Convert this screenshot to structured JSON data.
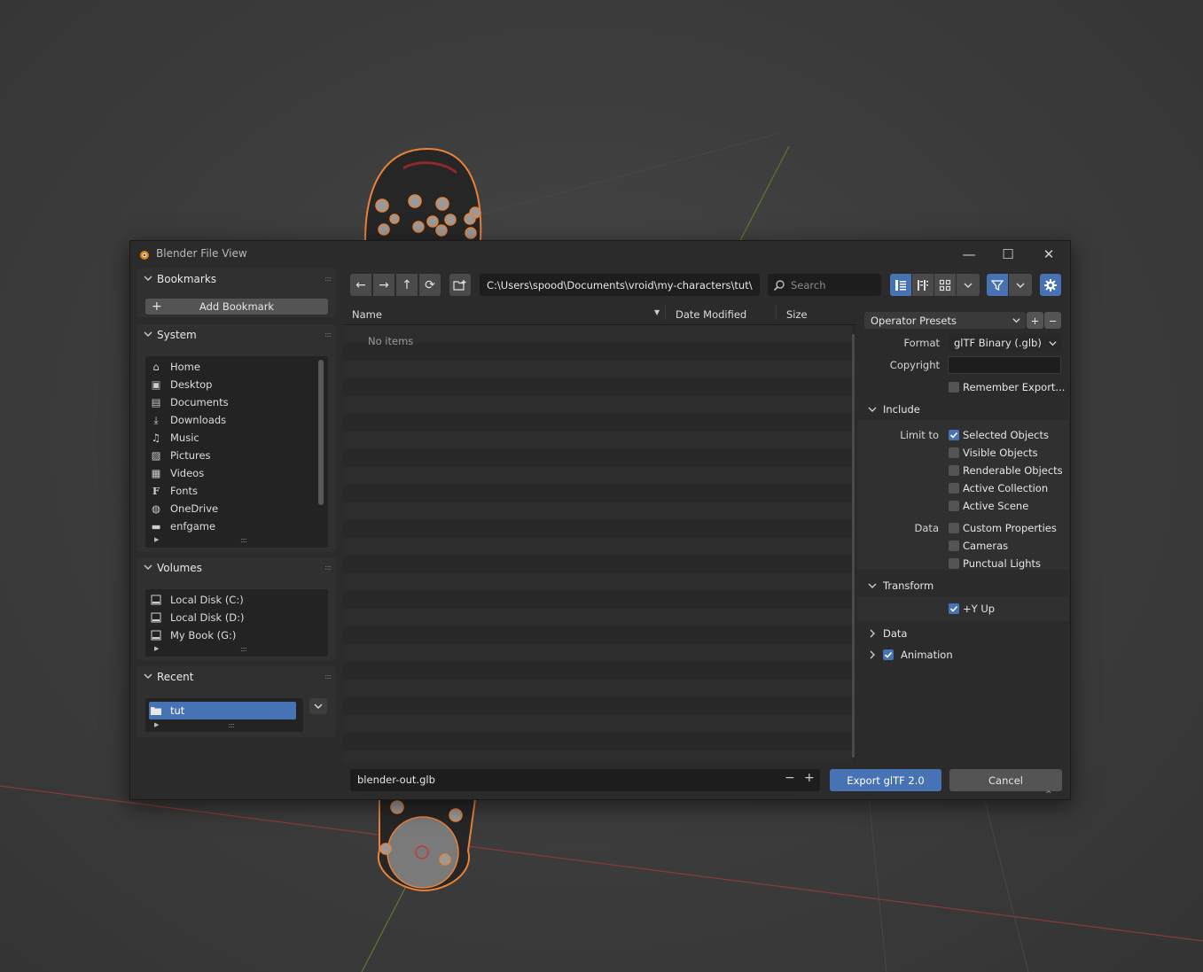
{
  "window": {
    "title": "Blender File View",
    "minimize_glyph": "—",
    "maximize_glyph": "☐",
    "close_glyph": "✕"
  },
  "sidebar": {
    "bookmarks": {
      "title": "Bookmarks",
      "add_label": "Add Bookmark",
      "add_icon": "+"
    },
    "system": {
      "title": "System",
      "items": [
        {
          "label": "Home",
          "icon": "home-icon",
          "glyph": "⌂"
        },
        {
          "label": "Desktop",
          "icon": "desktop-icon",
          "glyph": "▣"
        },
        {
          "label": "Documents",
          "icon": "documents-icon",
          "glyph": "▤"
        },
        {
          "label": "Downloads",
          "icon": "downloads-icon",
          "glyph": "⤓"
        },
        {
          "label": "Music",
          "icon": "music-icon",
          "glyph": "♫"
        },
        {
          "label": "Pictures",
          "icon": "pictures-icon",
          "glyph": "▨"
        },
        {
          "label": "Videos",
          "icon": "videos-icon",
          "glyph": "▦"
        },
        {
          "label": "Fonts",
          "icon": "fonts-icon",
          "glyph": "F"
        },
        {
          "label": "OneDrive",
          "icon": "globe-icon",
          "glyph": "◍"
        },
        {
          "label": "enfgame",
          "icon": "folder-icon",
          "glyph": "▬"
        }
      ]
    },
    "volumes": {
      "title": "Volumes",
      "items": [
        {
          "label": "Local Disk (C:)",
          "icon": "disk-icon"
        },
        {
          "label": "Local Disk (D:)",
          "icon": "disk-icon"
        },
        {
          "label": "My Book (G:)",
          "icon": "disk-icon"
        }
      ]
    },
    "recent": {
      "title": "Recent",
      "items": [
        {
          "label": "tut",
          "icon": "folder-icon",
          "selected": true
        }
      ]
    }
  },
  "toolbar": {
    "back": "←",
    "forward": "→",
    "parent": "↑",
    "refresh": "⟳",
    "path": "C:\\Users\\spood\\Documents\\vroid\\my-characters\\tut\\",
    "search_placeholder": "Search"
  },
  "filelist": {
    "columns": [
      "Name",
      "Date Modified",
      "Size"
    ],
    "empty_text": "No items"
  },
  "options": {
    "operator_presets": "Operator Presets",
    "format_label": "Format",
    "format_value": "glTF Binary (.glb)",
    "copyright_label": "Copyright",
    "copyright_value": "",
    "remember_label": "Remember Export...",
    "remember_checked": false,
    "include": {
      "title": "Include",
      "limit_to_label": "Limit to",
      "limit_to": [
        {
          "label": "Selected Objects",
          "checked": true
        },
        {
          "label": "Visible Objects",
          "checked": false
        },
        {
          "label": "Renderable Objects",
          "checked": false
        },
        {
          "label": "Active Collection",
          "checked": false
        },
        {
          "label": "Active Scene",
          "checked": false
        }
      ],
      "data_label": "Data",
      "data": [
        {
          "label": "Custom Properties",
          "checked": false
        },
        {
          "label": "Cameras",
          "checked": false
        },
        {
          "label": "Punctual Lights",
          "checked": false
        }
      ]
    },
    "transform": {
      "title": "Transform",
      "y_up_label": "+Y Up",
      "y_up_checked": true
    },
    "data_section": {
      "title": "Data"
    },
    "animation_section": {
      "title": "Animation",
      "checked": true
    }
  },
  "bottom": {
    "filename": "blender-out.glb",
    "export_label": "Export glTF 2.0",
    "cancel_label": "Cancel",
    "minus": "−",
    "plus": "+"
  },
  "colors": {
    "accent": "#4772b3",
    "window_bg": "#2b2b2b",
    "viewport_bg": "#3d3d3d",
    "selection_outline": "#e8823a"
  }
}
